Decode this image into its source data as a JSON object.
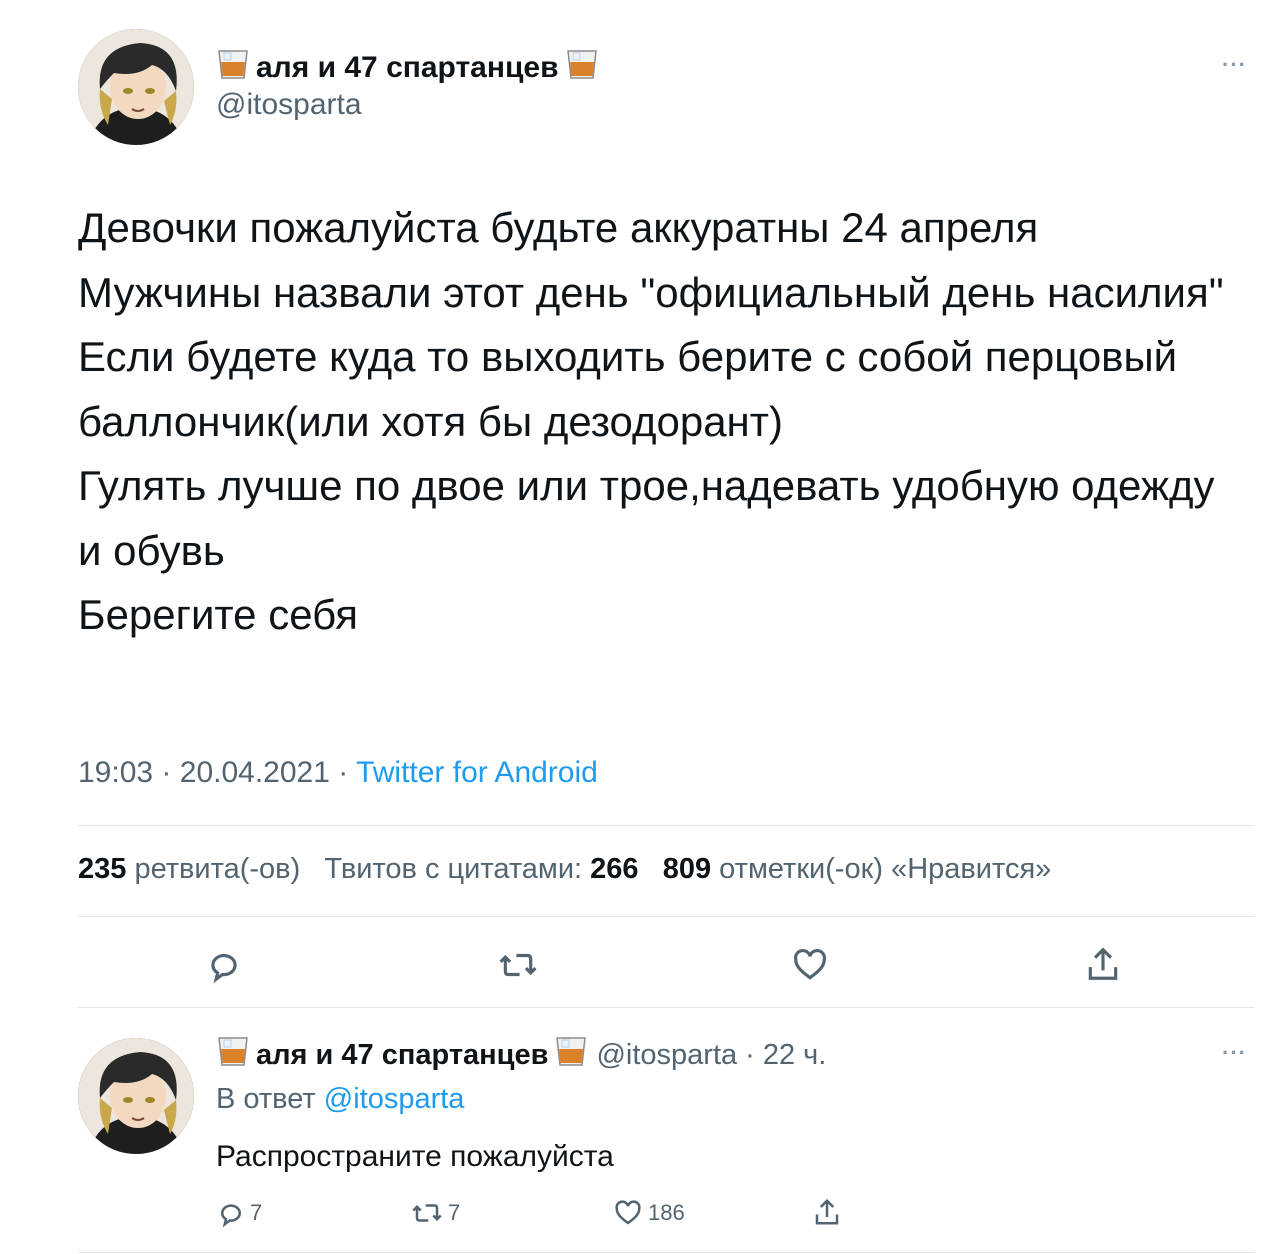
{
  "main_tweet": {
    "display_name": "аля и 47 спартанцев",
    "handle": "@itosparta",
    "more_label": "···",
    "text": "Девочки пожалуйста будьте аккуратны 24 апреля\nМужчины назвали этот день \"официальный день насилия\"\nЕсли будете куда то выходить берите с собой перцовый баллончик(или хотя бы дезодорант)\nГулять лучше по двое или трое,надевать удобную одежду и обувь\nБерегите себя",
    "time": "19:03",
    "date": "20.04.2021",
    "separator": "·",
    "source": "Twitter for Android",
    "stats": {
      "retweets_count": "235",
      "retweets_label": "ретвита(-ов)",
      "quotes_label": "Твитов с цитатами:",
      "quotes_count": "266",
      "likes_count": "809",
      "likes_label": "отметки(-ок) «Нравится»"
    }
  },
  "reply_tweet": {
    "display_name": "аля и 47 спартанцев",
    "handle": "@itosparta",
    "separator": "·",
    "time_ago": "22 ч.",
    "more_label": "···",
    "reply_prefix": "В ответ",
    "reply_to": "@itosparta",
    "text": "Распространите пожалуйста",
    "replies": "7",
    "retweets": "7",
    "likes": "186"
  },
  "icons": [
    "whisky-glass-icon",
    "reply-icon",
    "retweet-icon",
    "like-icon",
    "share-icon",
    "more-icon"
  ],
  "colors": {
    "link": "#1d9bf0",
    "muted": "#536471",
    "text": "#0f1419",
    "divider": "#e1e6ea"
  }
}
